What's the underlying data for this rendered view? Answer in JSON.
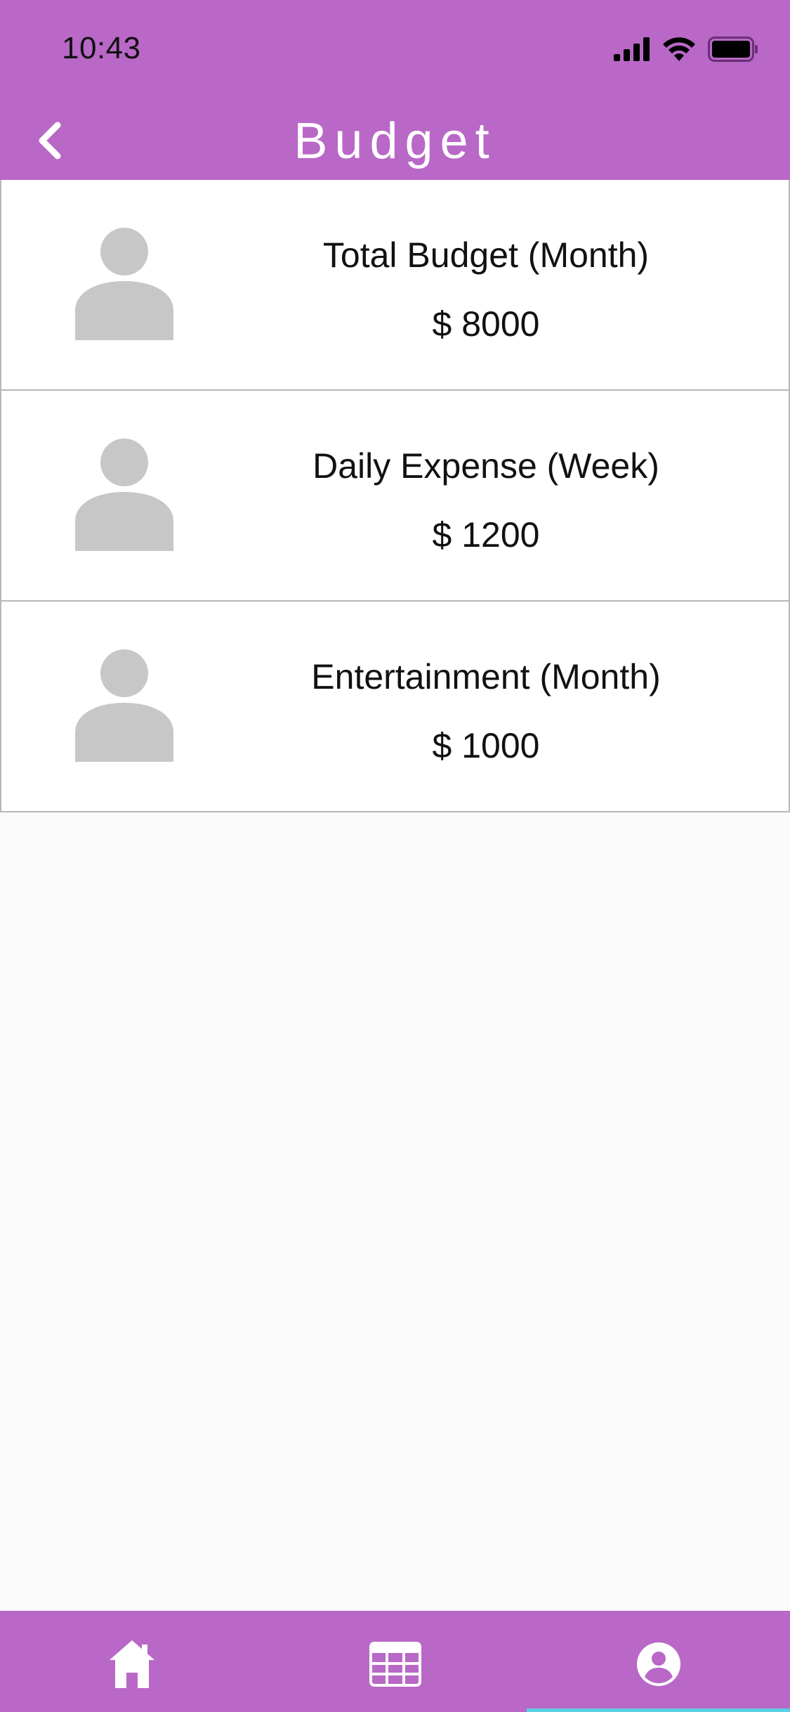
{
  "status_bar": {
    "time": "10:43",
    "icons": [
      "signal-icon",
      "wifi-icon",
      "battery-icon"
    ]
  },
  "header": {
    "title": "Budget",
    "back_icon": "chevron-left-icon"
  },
  "budgets": [
    {
      "title": "Total Budget (Month)",
      "amount": "$ 8000",
      "icon": "person-placeholder-icon"
    },
    {
      "title": "Daily Expense (Week)",
      "amount": "$ 1200",
      "icon": "person-placeholder-icon"
    },
    {
      "title": "Entertainment (Month)",
      "amount": "$ 1000",
      "icon": "person-placeholder-icon"
    }
  ],
  "tabbar": {
    "tabs": [
      {
        "icon": "home-icon"
      },
      {
        "icon": "calendar-grid-icon"
      },
      {
        "icon": "account-circle-icon",
        "selected": true
      }
    ]
  },
  "colors": {
    "accent": "#b968c7",
    "placeholder": "#c7c7c7",
    "indicator": "#5ad0e6"
  }
}
